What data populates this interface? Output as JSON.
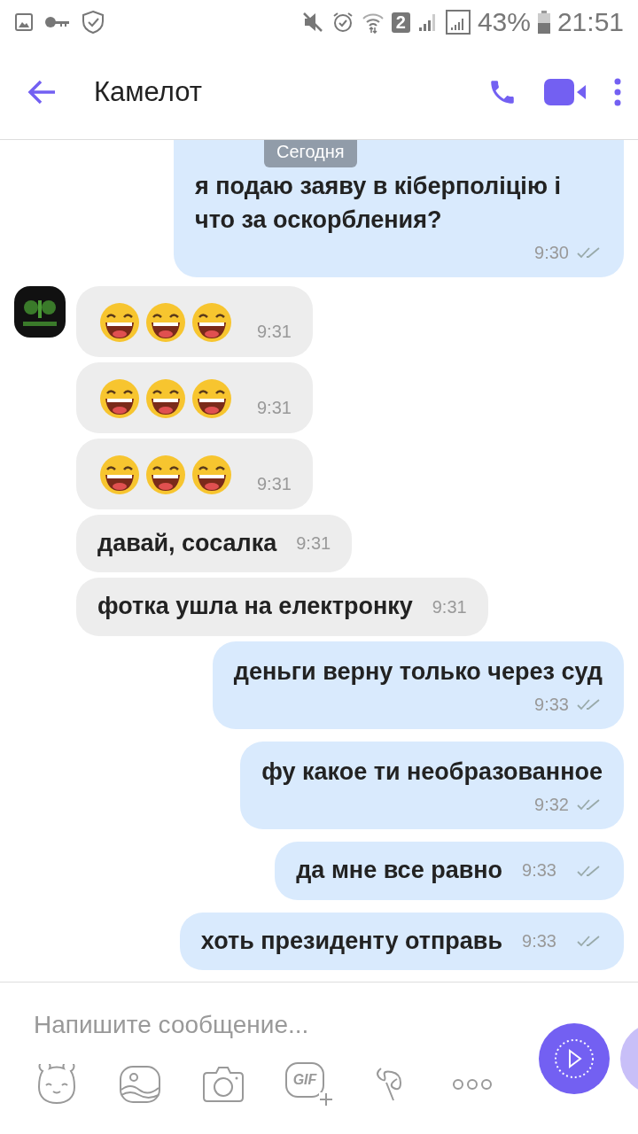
{
  "status_bar": {
    "battery": "43%",
    "time": "21:51",
    "sim": "2"
  },
  "header": {
    "title": "Камелот"
  },
  "date_badge": "Сегодня",
  "messages": [
    {
      "kind": "out",
      "text": "я подаю заяву в кіберполіцію і что за оскорбления?",
      "time": "9:30"
    },
    {
      "kind": "emoji",
      "time": "9:31",
      "avatar": true
    },
    {
      "kind": "emoji",
      "time": "9:31",
      "avatar": false
    },
    {
      "kind": "emoji",
      "time": "9:31",
      "avatar": false
    },
    {
      "kind": "in",
      "text": "давай, сосалка",
      "time": "9:31",
      "avatar": false
    },
    {
      "kind": "in",
      "text": "фотка ушла на електронку",
      "time": "9:31",
      "avatar": false
    },
    {
      "kind": "out",
      "text": "деньги верну только через суд",
      "time": "9:33"
    },
    {
      "kind": "out",
      "text": "фу какое ти необразованное",
      "time": "9:32"
    },
    {
      "kind": "out_inline",
      "text": "да мне все равно",
      "time": "9:33"
    },
    {
      "kind": "out_inline",
      "text": "хоть президенту отправь",
      "time": "9:33"
    }
  ],
  "composer": {
    "placeholder": "Напишите сообщение...",
    "gif_label": "GIF"
  }
}
